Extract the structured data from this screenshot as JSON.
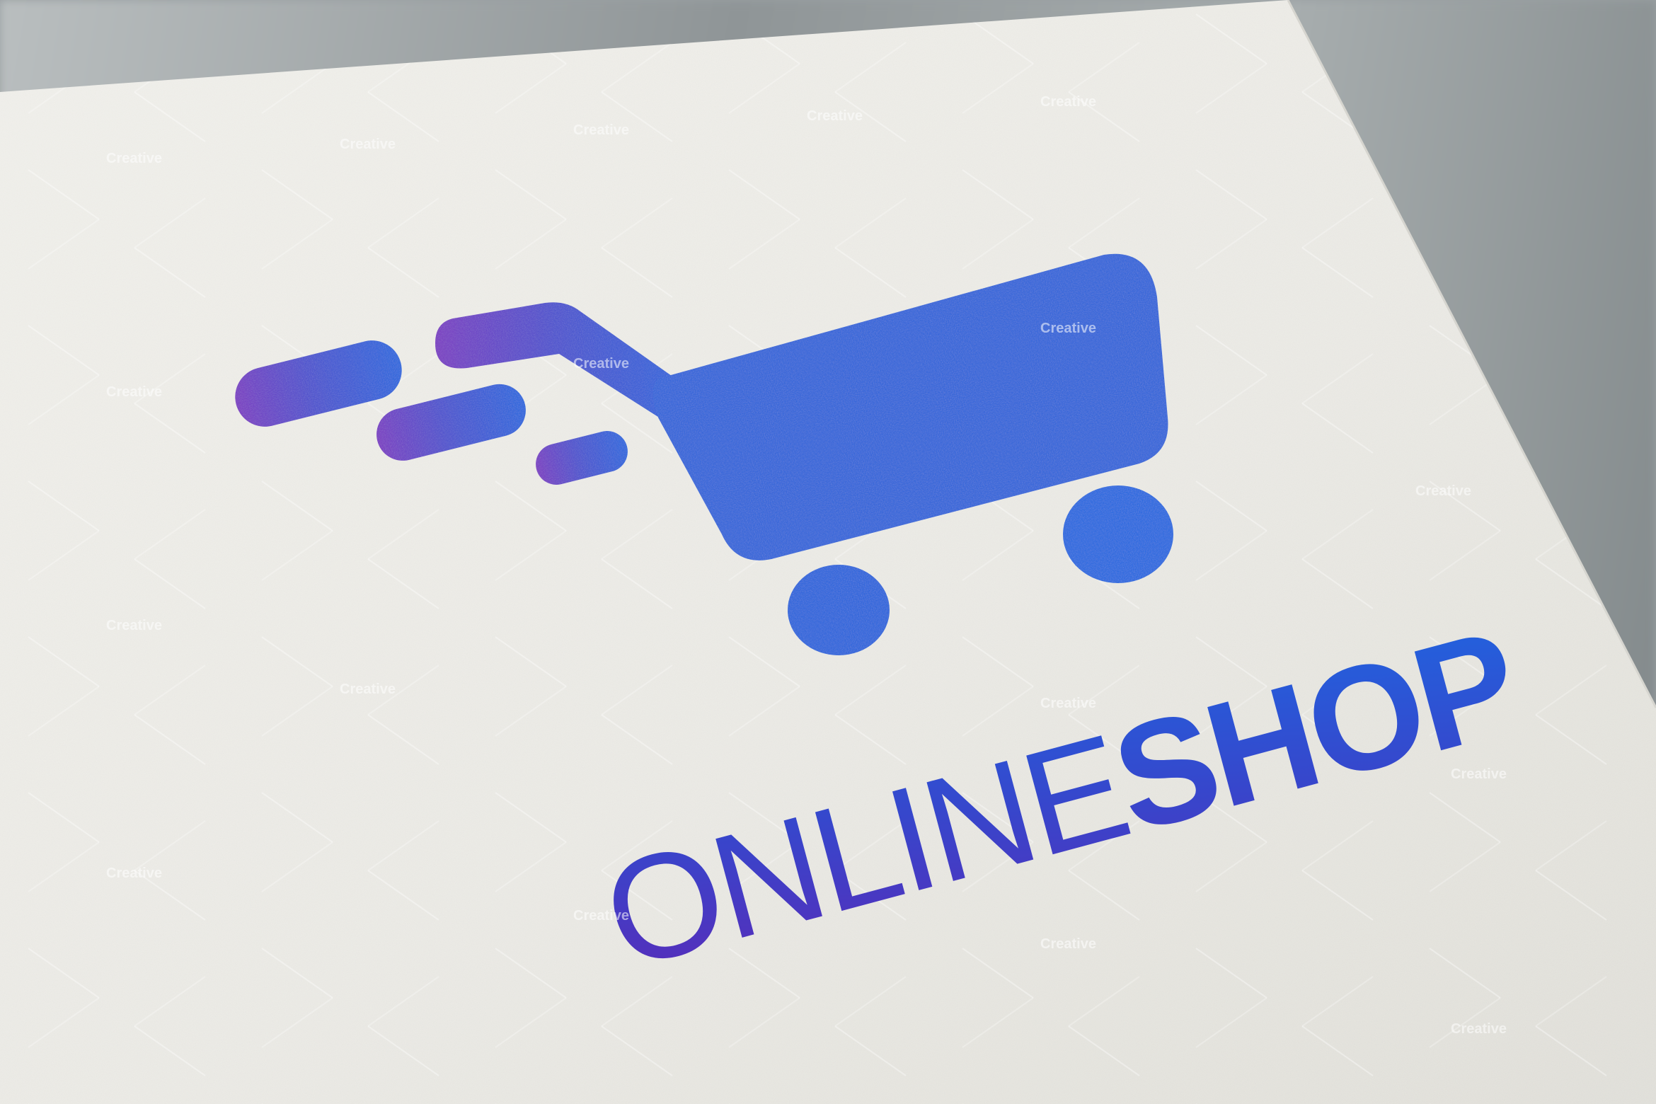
{
  "image": {
    "wordmark": "ONLINESHOP",
    "wordmark_parts": [
      "ONLINE",
      "SHOP"
    ],
    "watermark_text": "Creative",
    "colors": {
      "purple": "#7a35c4",
      "blue": "#1f66e0",
      "paper": "#ecebe6",
      "background": "#9aa0a3"
    },
    "icon": "shopping-cart-icon"
  }
}
